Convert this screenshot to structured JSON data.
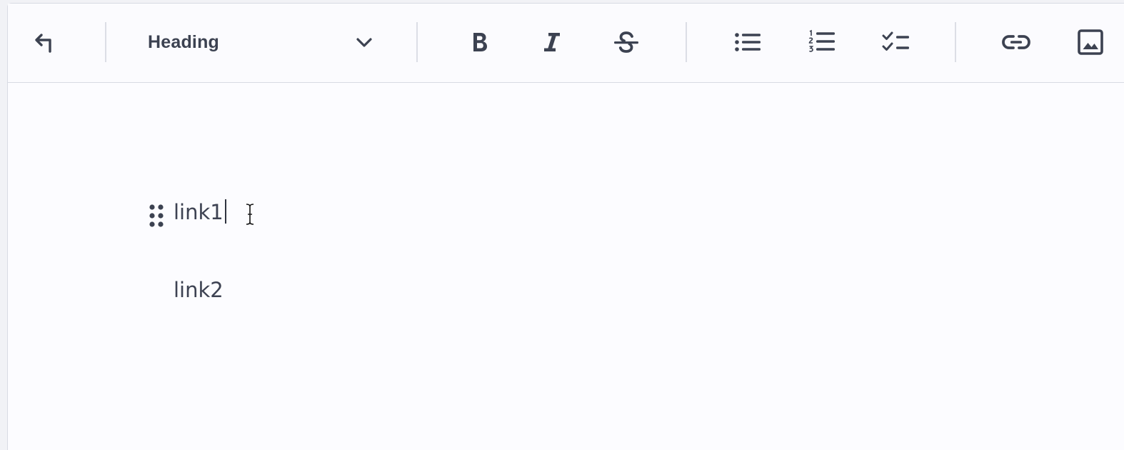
{
  "toolbar": {
    "buttons": {
      "undo": {
        "icon": "undo-arrow-icon"
      },
      "bold": {
        "icon": "bold-icon"
      },
      "italic": {
        "icon": "italic-icon"
      },
      "strikethrough": {
        "icon": "strikethrough-icon"
      },
      "bullet_list": {
        "icon": "bullet-list-icon"
      },
      "ordered_list": {
        "icon": "ordered-list-icon"
      },
      "task_list": {
        "icon": "checklist-icon"
      },
      "link": {
        "icon": "link-icon"
      },
      "image": {
        "icon": "image-icon"
      }
    },
    "block_type": {
      "selected": "Heading",
      "icon": "chevron-down-icon"
    }
  },
  "document": {
    "paragraphs": [
      {
        "text": "link1"
      },
      {
        "text": "link2"
      }
    ]
  },
  "colors": {
    "icon": "#3c4251",
    "text": "#3d4252",
    "border": "#d8dbe3",
    "background": "#fcfcff"
  }
}
